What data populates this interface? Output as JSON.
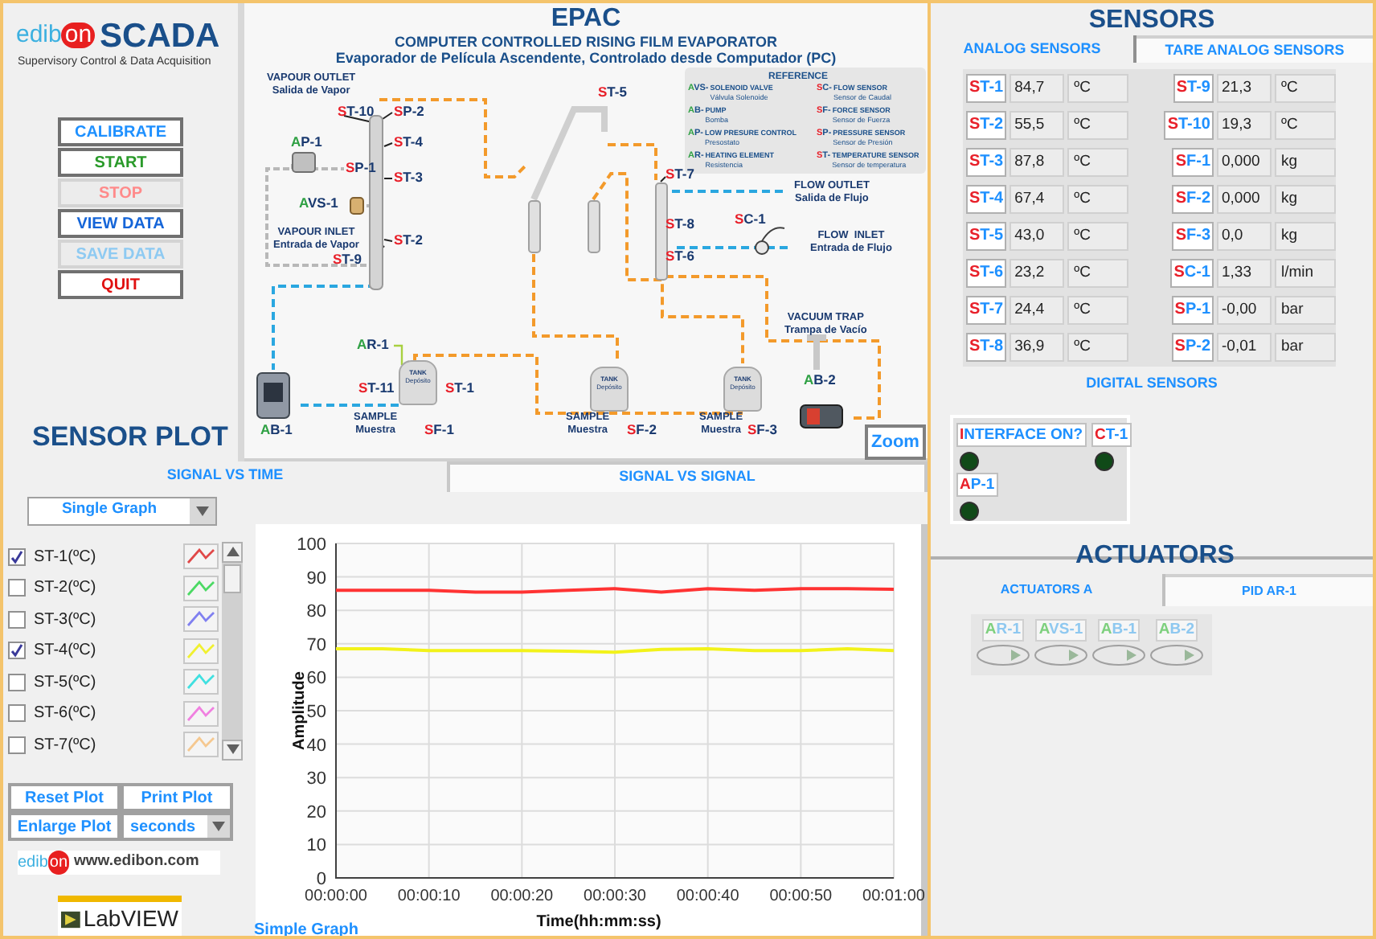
{
  "header": {
    "brand": "edibon",
    "title": "SCADA",
    "subtitle": "Supervisory Control & Data Acquisition"
  },
  "buttons": [
    {
      "label": "CALIBRATE",
      "color": "#1e90ff",
      "disabled": false
    },
    {
      "label": "START",
      "color": "#2a9a2a",
      "disabled": false
    },
    {
      "label": "STOP",
      "color": "#ff8a8a",
      "disabled": true
    },
    {
      "label": "VIEW DATA",
      "color": "#1565d8",
      "disabled": false
    },
    {
      "label": "SAVE DATA",
      "color": "#8ecaf2",
      "disabled": true
    },
    {
      "label": "QUIT",
      "color": "#e01010",
      "disabled": false
    }
  ],
  "diagram": {
    "title": "EPAC",
    "subtitle": "COMPUTER CONTROLLED RISING FILM EVAPORATOR",
    "subtitle_es": "Evaporador de Película Ascendente, Controlado desde Computador (PC)",
    "reference": {
      "title": "REFERENCE",
      "items": [
        {
          "code": "AVS-",
          "color": "#2ea043",
          "name": "SOLENOID VALVE",
          "name_es": "Válvula Solenoide"
        },
        {
          "code": "SC-",
          "color": "#e8202a",
          "name": "FLOW SENSOR",
          "name_es": "Sensor de Caudal"
        },
        {
          "code": "AB-",
          "color": "#2ea043",
          "name": "PUMP",
          "name_es": "Bomba"
        },
        {
          "code": "SF-",
          "color": "#e8202a",
          "name": "FORCE SENSOR",
          "name_es": "Sensor de Fuerza"
        },
        {
          "code": "AP-",
          "color": "#2ea043",
          "name": "LOW PRESURE CONTROL",
          "name_es": "Presostato"
        },
        {
          "code": "SP-",
          "color": "#e8202a",
          "name": "PRESSURE SENSOR",
          "name_es": "Sensor de Presión"
        },
        {
          "code": "AR-",
          "color": "#2ea043",
          "name": "HEATING ELEMENT",
          "name_es": "Resistencia"
        },
        {
          "code": "ST-",
          "color": "#e8202a",
          "name": "TEMPERATURE SENSOR",
          "name_es": "Sensor de temperatura"
        }
      ]
    },
    "tags": [
      {
        "text": "ST-10",
        "color": "#e8202a"
      },
      {
        "text": "SP-2",
        "color": "#e8202a"
      },
      {
        "text": "AP-1",
        "color": "#2ea043"
      },
      {
        "text": "ST-4",
        "color": "#e8202a"
      },
      {
        "text": "SP-1",
        "color": "#e8202a"
      },
      {
        "text": "ST-3",
        "color": "#e8202a"
      },
      {
        "text": "AVS-1",
        "color": "#2ea043"
      },
      {
        "text": "ST-2",
        "color": "#e8202a"
      },
      {
        "text": "ST-9",
        "color": "#e8202a"
      },
      {
        "text": "ST-5",
        "color": "#e8202a"
      },
      {
        "text": "ST-7",
        "color": "#e8202a"
      },
      {
        "text": "SC-1",
        "color": "#e8202a"
      },
      {
        "text": "ST-8",
        "color": "#e8202a"
      },
      {
        "text": "ST-6",
        "color": "#e8202a"
      },
      {
        "text": "AR-1",
        "color": "#2ea043"
      },
      {
        "text": "ST-11",
        "color": "#e8202a"
      },
      {
        "text": "ST-1",
        "color": "#e8202a"
      },
      {
        "text": "AB-1",
        "color": "#2ea043"
      },
      {
        "text": "SF-1",
        "color": "#e8202a"
      },
      {
        "text": "SF-2",
        "color": "#e8202a"
      },
      {
        "text": "SF-3",
        "color": "#e8202a"
      },
      {
        "text": "AB-2",
        "color": "#2ea043"
      }
    ],
    "labels": [
      {
        "text": "VAPOUR OUTLET",
        "text_es": "Salida de Vapor"
      },
      {
        "text": "VAPOUR INLET",
        "text_es": "Entrada de Vapor"
      },
      {
        "text": "FLOW OUTLET",
        "text_es": "Salida de Flujo"
      },
      {
        "text": "FLOW  INLET",
        "text_es": "Entrada de Flujo"
      },
      {
        "text": "VACUUM TRAP",
        "text_es": "Trampa de Vacío"
      },
      {
        "text": "SAMPLE",
        "text_es": "Muestra"
      },
      {
        "text": "SAMPLE",
        "text_es": "Muestra"
      },
      {
        "text": "SAMPLE",
        "text_es": "Muestra"
      }
    ],
    "tanks": [
      {
        "label": "TANK",
        "label_es": "Depósito"
      },
      {
        "label": "TANK",
        "label_es": "Depósito"
      },
      {
        "label": "TANK",
        "label_es": "Depósito"
      }
    ],
    "zoom": "Zoom"
  },
  "sensor_plot": {
    "title": "SENSOR PLOT",
    "tabs": [
      {
        "label": "SIGNAL VS TIME",
        "selected": true
      },
      {
        "label": "SIGNAL VS SIGNAL",
        "selected": false
      }
    ],
    "mode": "Single Graph",
    "signals": [
      {
        "label": "ST-1(ºC)",
        "checked": true,
        "color": "#e04848"
      },
      {
        "label": "ST-2(ºC)",
        "checked": false,
        "color": "#4cd964"
      },
      {
        "label": "ST-3(ºC)",
        "checked": false,
        "color": "#8080f0"
      },
      {
        "label": "ST-4(ºC)",
        "checked": true,
        "color": "#f0f030"
      },
      {
        "label": "ST-5(ºC)",
        "checked": false,
        "color": "#40e0e0"
      },
      {
        "label": "ST-6(ºC)",
        "checked": false,
        "color": "#f080e0"
      },
      {
        "label": "ST-7(ºC)",
        "checked": false,
        "color": "#f5c890"
      }
    ],
    "buttons": [
      "Reset Plot",
      "Print Plot",
      "Enlarge Plot"
    ],
    "time_unit": "seconds",
    "website_brand": "edibon",
    "website": "www.edibon.com",
    "labview": "LabVIEW",
    "graph_label": "Simple Graph",
    "chart_data": {
      "type": "line",
      "xlabel": "Time(hh:mm:ss)",
      "ylabel": "Amplitude",
      "x": [
        0,
        5,
        10,
        15,
        20,
        25,
        30,
        35,
        40,
        45,
        50,
        55,
        60
      ],
      "grid": true,
      "series": [
        {
          "color": "#ff3333",
          "values": [
            86,
            86,
            86,
            85.5,
            85.5,
            86,
            86.5,
            85.5,
            86.5,
            86,
            86.5,
            86.5,
            86.3
          ]
        },
        {
          "color": "#f2f21a",
          "values": [
            68.5,
            68.5,
            68,
            68,
            68,
            67.8,
            67.5,
            68.3,
            68.5,
            68,
            68,
            68.5,
            68
          ]
        }
      ],
      "xlim": [
        0,
        60
      ],
      "ylim": [
        0,
        100
      ],
      "xticks": [
        {
          "value": 0,
          "label": "00:00:00"
        },
        {
          "value": 10,
          "label": "00:00:10"
        },
        {
          "value": 20,
          "label": "00:00:20"
        },
        {
          "value": 30,
          "label": "00:00:30"
        },
        {
          "value": 40,
          "label": "00:00:40"
        },
        {
          "value": 50,
          "label": "00:00:50"
        },
        {
          "value": 60,
          "label": "00:01:00"
        }
      ],
      "yticks": [
        0,
        10,
        20,
        30,
        40,
        50,
        60,
        70,
        80,
        90,
        100
      ]
    }
  },
  "sensors": {
    "title": "SENSORS",
    "tabs": [
      {
        "label": "ANALOG SENSORS",
        "selected": true
      },
      {
        "label": "TARE ANALOG SENSORS",
        "selected": false
      }
    ],
    "analog": [
      {
        "tag": "ST-1",
        "value": "84,7",
        "unit": "ºC"
      },
      {
        "tag": "ST-9",
        "value": "21,3",
        "unit": "ºC"
      },
      {
        "tag": "ST-2",
        "value": "55,5",
        "unit": "ºC"
      },
      {
        "tag": "ST-10",
        "value": "19,3",
        "unit": "ºC"
      },
      {
        "tag": "ST-3",
        "value": "87,8",
        "unit": "ºC"
      },
      {
        "tag": "SF-1",
        "value": "0,000",
        "unit": "kg"
      },
      {
        "tag": "ST-4",
        "value": "67,4",
        "unit": "ºC"
      },
      {
        "tag": "SF-2",
        "value": "0,000",
        "unit": "kg"
      },
      {
        "tag": "ST-5",
        "value": "43,0",
        "unit": "ºC"
      },
      {
        "tag": "SF-3",
        "value": "0,0",
        "unit": "kg"
      },
      {
        "tag": "ST-6",
        "value": "23,2",
        "unit": "ºC"
      },
      {
        "tag": "SC-1",
        "value": "1,33",
        "unit": "l/min"
      },
      {
        "tag": "ST-7",
        "value": "24,4",
        "unit": "ºC"
      },
      {
        "tag": "SP-1",
        "value": "-0,00",
        "unit": "bar"
      },
      {
        "tag": "ST-8",
        "value": "36,9",
        "unit": "ºC"
      },
      {
        "tag": "SP-2",
        "value": "-0,01",
        "unit": "bar"
      }
    ]
  },
  "digital_sensors": {
    "title": "DIGITAL SENSORS",
    "items": [
      {
        "label": "INTERFACE ON?",
        "on": false
      },
      {
        "label": "CT-1",
        "on": false
      },
      {
        "label": "AP-1",
        "on": false
      }
    ]
  },
  "actuators": {
    "title": "ACTUATORS",
    "tabs": [
      {
        "label": "ACTUATORS A",
        "selected": true
      },
      {
        "label": "PID AR-1",
        "selected": false
      }
    ],
    "items": [
      {
        "label": "AR-1",
        "on": false
      },
      {
        "label": "AVS-1",
        "on": false
      },
      {
        "label": "AB-1",
        "on": false
      },
      {
        "label": "AB-2",
        "on": false
      }
    ]
  }
}
